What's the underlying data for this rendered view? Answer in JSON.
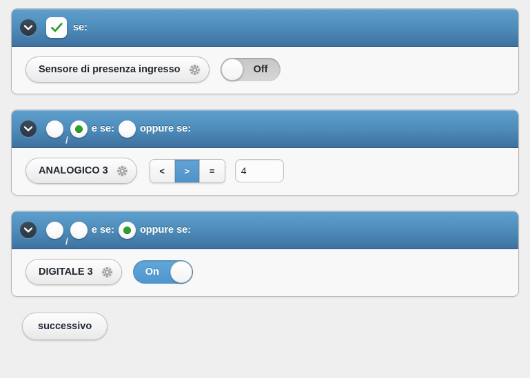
{
  "colors": {
    "page_background": "#efefef",
    "header_blue_top": "#5e9fcc",
    "header_blue_bottom": "#3f719f",
    "accent_blue": "#4f93c9",
    "radio_green": "#2aa12a",
    "check_green": "#2f9e2f"
  },
  "panels": [
    {
      "id": "panel-se",
      "collapse_icon": "chevron-down-icon",
      "header": {
        "checkbox": {
          "icon": "check-icon",
          "checked": true
        },
        "label": "se:"
      },
      "row": {
        "device": {
          "label": "Sensore di presenza ingresso",
          "icon": "gear-icon"
        },
        "toggle": {
          "state": "off",
          "label": "Off"
        }
      }
    },
    {
      "id": "panel-e-se",
      "collapse_icon": "chevron-down-icon",
      "header": {
        "radios": [
          {
            "name": "radio-slot-1",
            "selected": false
          },
          {
            "name": "radio-slot-2",
            "selected": true
          },
          {
            "name": "radio-slot-3",
            "selected": false
          }
        ],
        "separator": "/",
        "label_middle": "e se:",
        "label_end": "oppure se:"
      },
      "row": {
        "device": {
          "label": "ANALOGICO 3",
          "icon": "gear-icon"
        },
        "operators": [
          {
            "label": "<",
            "active": false
          },
          {
            "label": ">",
            "active": true
          },
          {
            "label": "=",
            "active": false
          }
        ],
        "value_input": {
          "value": "4",
          "placeholder": ""
        }
      }
    },
    {
      "id": "panel-oppure-se",
      "collapse_icon": "chevron-down-icon",
      "header": {
        "radios": [
          {
            "name": "radio-slot-1",
            "selected": false
          },
          {
            "name": "radio-slot-2",
            "selected": false
          },
          {
            "name": "radio-slot-3",
            "selected": true
          }
        ],
        "separator": "/",
        "label_middle": "e se:",
        "label_end": "oppure se:"
      },
      "row": {
        "device": {
          "label": "DIGITALE 3",
          "icon": "gear-icon"
        },
        "toggle": {
          "state": "on",
          "label": "On"
        }
      }
    }
  ],
  "footer": {
    "next_button_label": "successivo"
  }
}
